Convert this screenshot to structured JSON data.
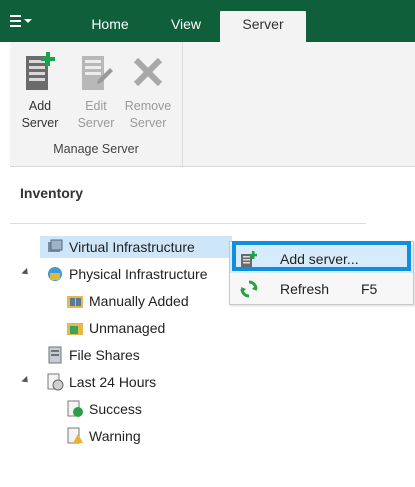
{
  "ribbon_tabs": {
    "menu_icon": "hamburger-menu-icon",
    "home": "Home",
    "view": "View",
    "server": "Server"
  },
  "ribbon": {
    "add_server": {
      "line1": "Add",
      "line2": "Server",
      "icon": "add-server-icon"
    },
    "edit_server": {
      "line1": "Edit",
      "line2": "Server",
      "icon": "edit-server-icon"
    },
    "remove_server": {
      "line1": "Remove",
      "line2": "Server",
      "icon": "remove-icon"
    },
    "group_label": "Manage Server"
  },
  "inventory": {
    "title": "Inventory",
    "tree": [
      {
        "label": "Virtual Infrastructure",
        "icon": "virtual-infrastructure-icon",
        "selected": true
      },
      {
        "label": "Physical Infrastructure",
        "icon": "physical-infrastructure-icon",
        "expanded": true
      },
      {
        "label": "Manually Added",
        "icon": "manually-added-icon"
      },
      {
        "label": "Unmanaged",
        "icon": "unmanaged-icon"
      },
      {
        "label": "File Shares",
        "icon": "file-shares-icon"
      },
      {
        "label": "Last 24 Hours",
        "icon": "last-24-hours-icon",
        "expanded": true
      },
      {
        "label": "Success",
        "icon": "success-icon"
      },
      {
        "label": "Warning",
        "icon": "warning-icon"
      }
    ]
  },
  "context_menu": {
    "items": [
      {
        "label": "Add server...",
        "icon": "add-server-icon",
        "shortcut": ""
      },
      {
        "label": "Refresh",
        "icon": "refresh-icon",
        "shortcut": "F5"
      }
    ]
  },
  "colors": {
    "tabbar": "#0f5f3a",
    "ribbon_bg": "#f3f3f3",
    "selection": "#cfe6f8",
    "highlight_border": "#0f8fdc"
  }
}
